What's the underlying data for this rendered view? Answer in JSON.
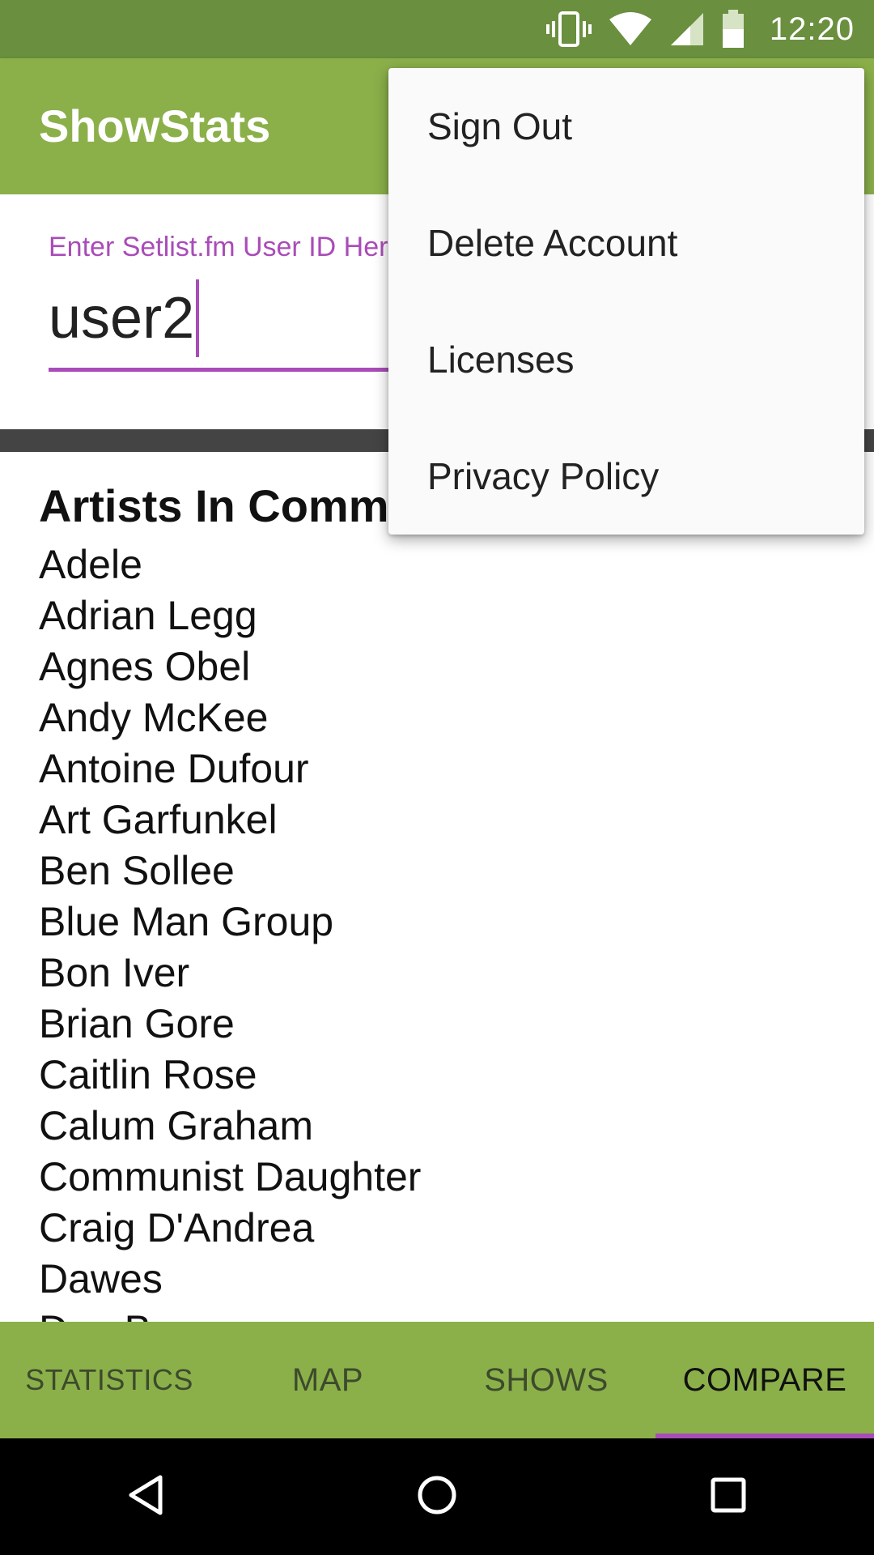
{
  "status_bar": {
    "time": "12:20",
    "icons": [
      "vibrate-icon",
      "wifi-icon",
      "signal-icon",
      "battery-icon"
    ]
  },
  "app_bar": {
    "title": "ShowStats"
  },
  "input": {
    "label": "Enter Setlist.fm User ID Here",
    "value": "user2"
  },
  "artists": {
    "heading": "Artists In Common",
    "items": [
      "Adele",
      "Adrian Legg",
      "Agnes Obel",
      "Andy McKee",
      "Antoine Dufour",
      "Art Garfunkel",
      "Ben Sollee",
      "Blue Man Group",
      "Bon Iver",
      "Brian Gore",
      "Caitlin Rose",
      "Calum Graham",
      "Communist Daughter",
      "Craig D'Andrea",
      "Dawes",
      "Dan Baa"
    ]
  },
  "menu": {
    "items": [
      "Sign Out",
      "Delete Account",
      "Licenses",
      "Privacy Policy"
    ]
  },
  "tabs": {
    "items": [
      "STATISTICS",
      "MAP",
      "SHOWS",
      "COMPARE"
    ],
    "active": "COMPARE"
  },
  "nav": {
    "icons": [
      "back-icon",
      "home-icon",
      "recents-icon"
    ]
  },
  "colors": {
    "status_bar": "#6a8f3e",
    "app_bar": "#8bb04a",
    "accent": "#a94cb8",
    "divider": "#444444",
    "nav_bar": "#000000"
  }
}
